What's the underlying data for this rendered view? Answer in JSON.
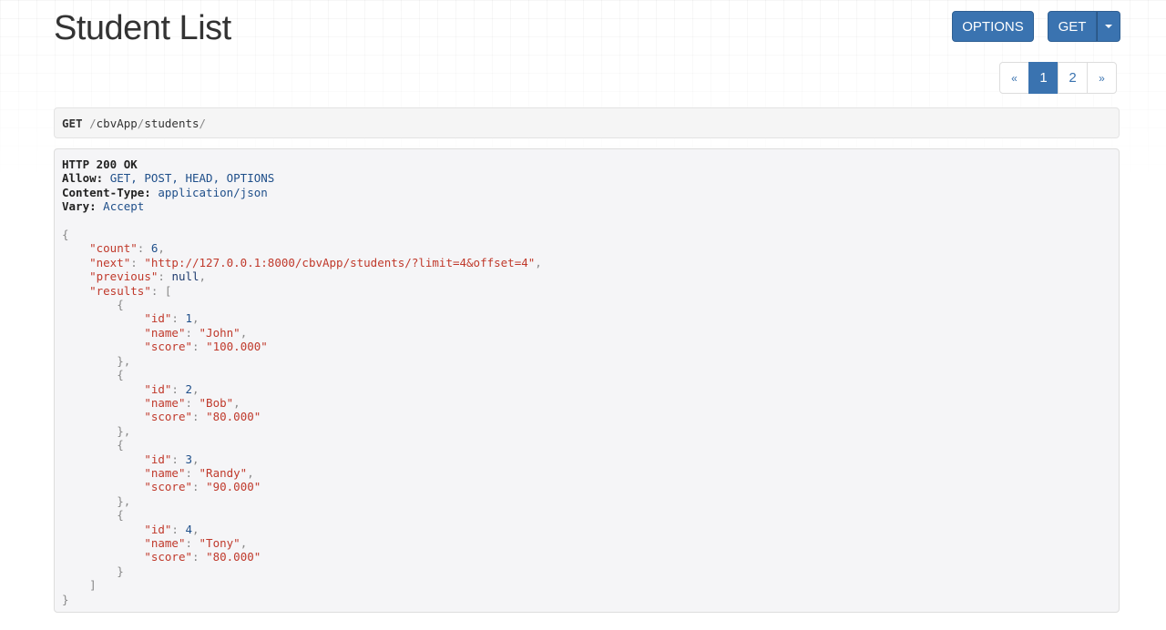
{
  "page": {
    "title": "Student List"
  },
  "toolbar": {
    "options_label": "OPTIONS",
    "get_label": "GET"
  },
  "pagination": {
    "prev_label": "«",
    "pages": [
      "1",
      "2"
    ],
    "active_page": "1",
    "next_label": "»"
  },
  "request": {
    "method": "GET",
    "path_parts": [
      "cbvApp",
      "students"
    ],
    "path": "/cbvApp/students/"
  },
  "response": {
    "status": "HTTP 200 OK",
    "headers": [
      {
        "key": "Allow:",
        "value": "GET, POST, HEAD, OPTIONS"
      },
      {
        "key": "Content-Type:",
        "value": "application/json"
      },
      {
        "key": "Vary:",
        "value": "Accept"
      }
    ],
    "body": {
      "count": "6",
      "next": "\"http://127.0.0.1:8000/cbvApp/students/?limit=4&offset=4\"",
      "previous": "null",
      "results": [
        {
          "id": "1",
          "name": "\"John\"",
          "score": "\"100.000\""
        },
        {
          "id": "2",
          "name": "\"Bob\"",
          "score": "\"80.000\""
        },
        {
          "id": "3",
          "name": "\"Randy\"",
          "score": "\"90.000\""
        },
        {
          "id": "4",
          "name": "\"Tony\"",
          "score": "\"80.000\""
        }
      ]
    }
  },
  "colors": {
    "primary": "#3a73b0",
    "json_key": "#c0392b",
    "json_number": "#1f4f8a"
  }
}
